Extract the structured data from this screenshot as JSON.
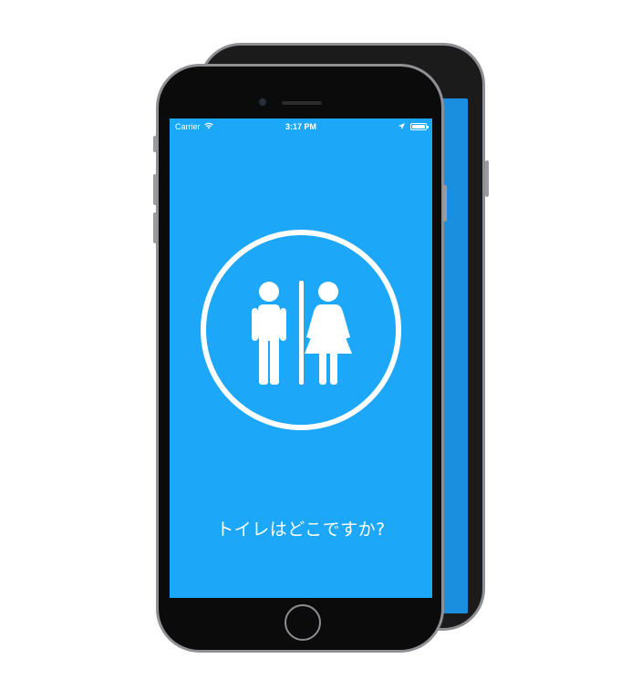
{
  "status_bar": {
    "carrier": "Carrier",
    "time": "3:17 PM",
    "icons": [
      "wifi-icon",
      "location-arrow-icon",
      "battery-icon"
    ]
  },
  "main": {
    "icon": "restroom-icon",
    "question": "トイレはどこですか?"
  },
  "colors": {
    "screen_background": "#1da7f8",
    "foreground": "#ffffff",
    "device_body": "#0b0b0c"
  }
}
